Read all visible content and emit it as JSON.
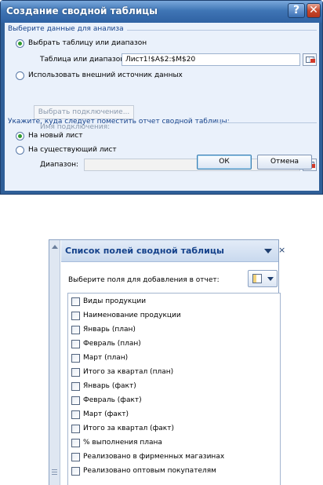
{
  "dialog": {
    "title": "Создание сводной таблицы",
    "help_glyph": "?",
    "close_glyph": "✕",
    "group_select": "Выберите данные для анализа",
    "radio_range_label": "Выбрать таблицу или диапазон",
    "range_label": "Таблица или диапазон:",
    "range_value": "Лист1!$A$2:$M$20",
    "radio_external_label": "Использовать внешний источник данных",
    "choose_connection_label": "Выбрать подключение...",
    "connection_name_label": "Имя подключения:",
    "group_location": "Укажите, куда следует поместить отчет сводной таблицы:",
    "radio_new_sheet_label": "На новый лист",
    "radio_existing_sheet_label": "На существующий лист",
    "location_label": "Диапазон:",
    "location_value": "",
    "ok_label": "ОК",
    "cancel_label": "Отмена",
    "selected_source": "range",
    "selected_location": "new_sheet"
  },
  "field_list": {
    "title": "Список полей сводной таблицы",
    "close_glyph": "×",
    "prompt": "Выберите поля для добавления в отчет:",
    "fields": [
      "Виды продукции",
      "Наименование продукции",
      "Январь (план)",
      "Февраль (план)",
      "Март (план)",
      "Итого за квартал (план)",
      "Январь (факт)",
      "Февраль (факт)",
      "Март (факт)",
      "Итого за квартал (факт)",
      "% выполнения плана",
      "Реализовано в фирменных магазинах",
      "Реализовано оптовым покупателям"
    ]
  },
  "colors": {
    "title_bar": "#3f75b5",
    "dialog_client": "#eaf1fb",
    "group_header_text": "#15428b",
    "radio_selected": "#2e9b2e"
  }
}
